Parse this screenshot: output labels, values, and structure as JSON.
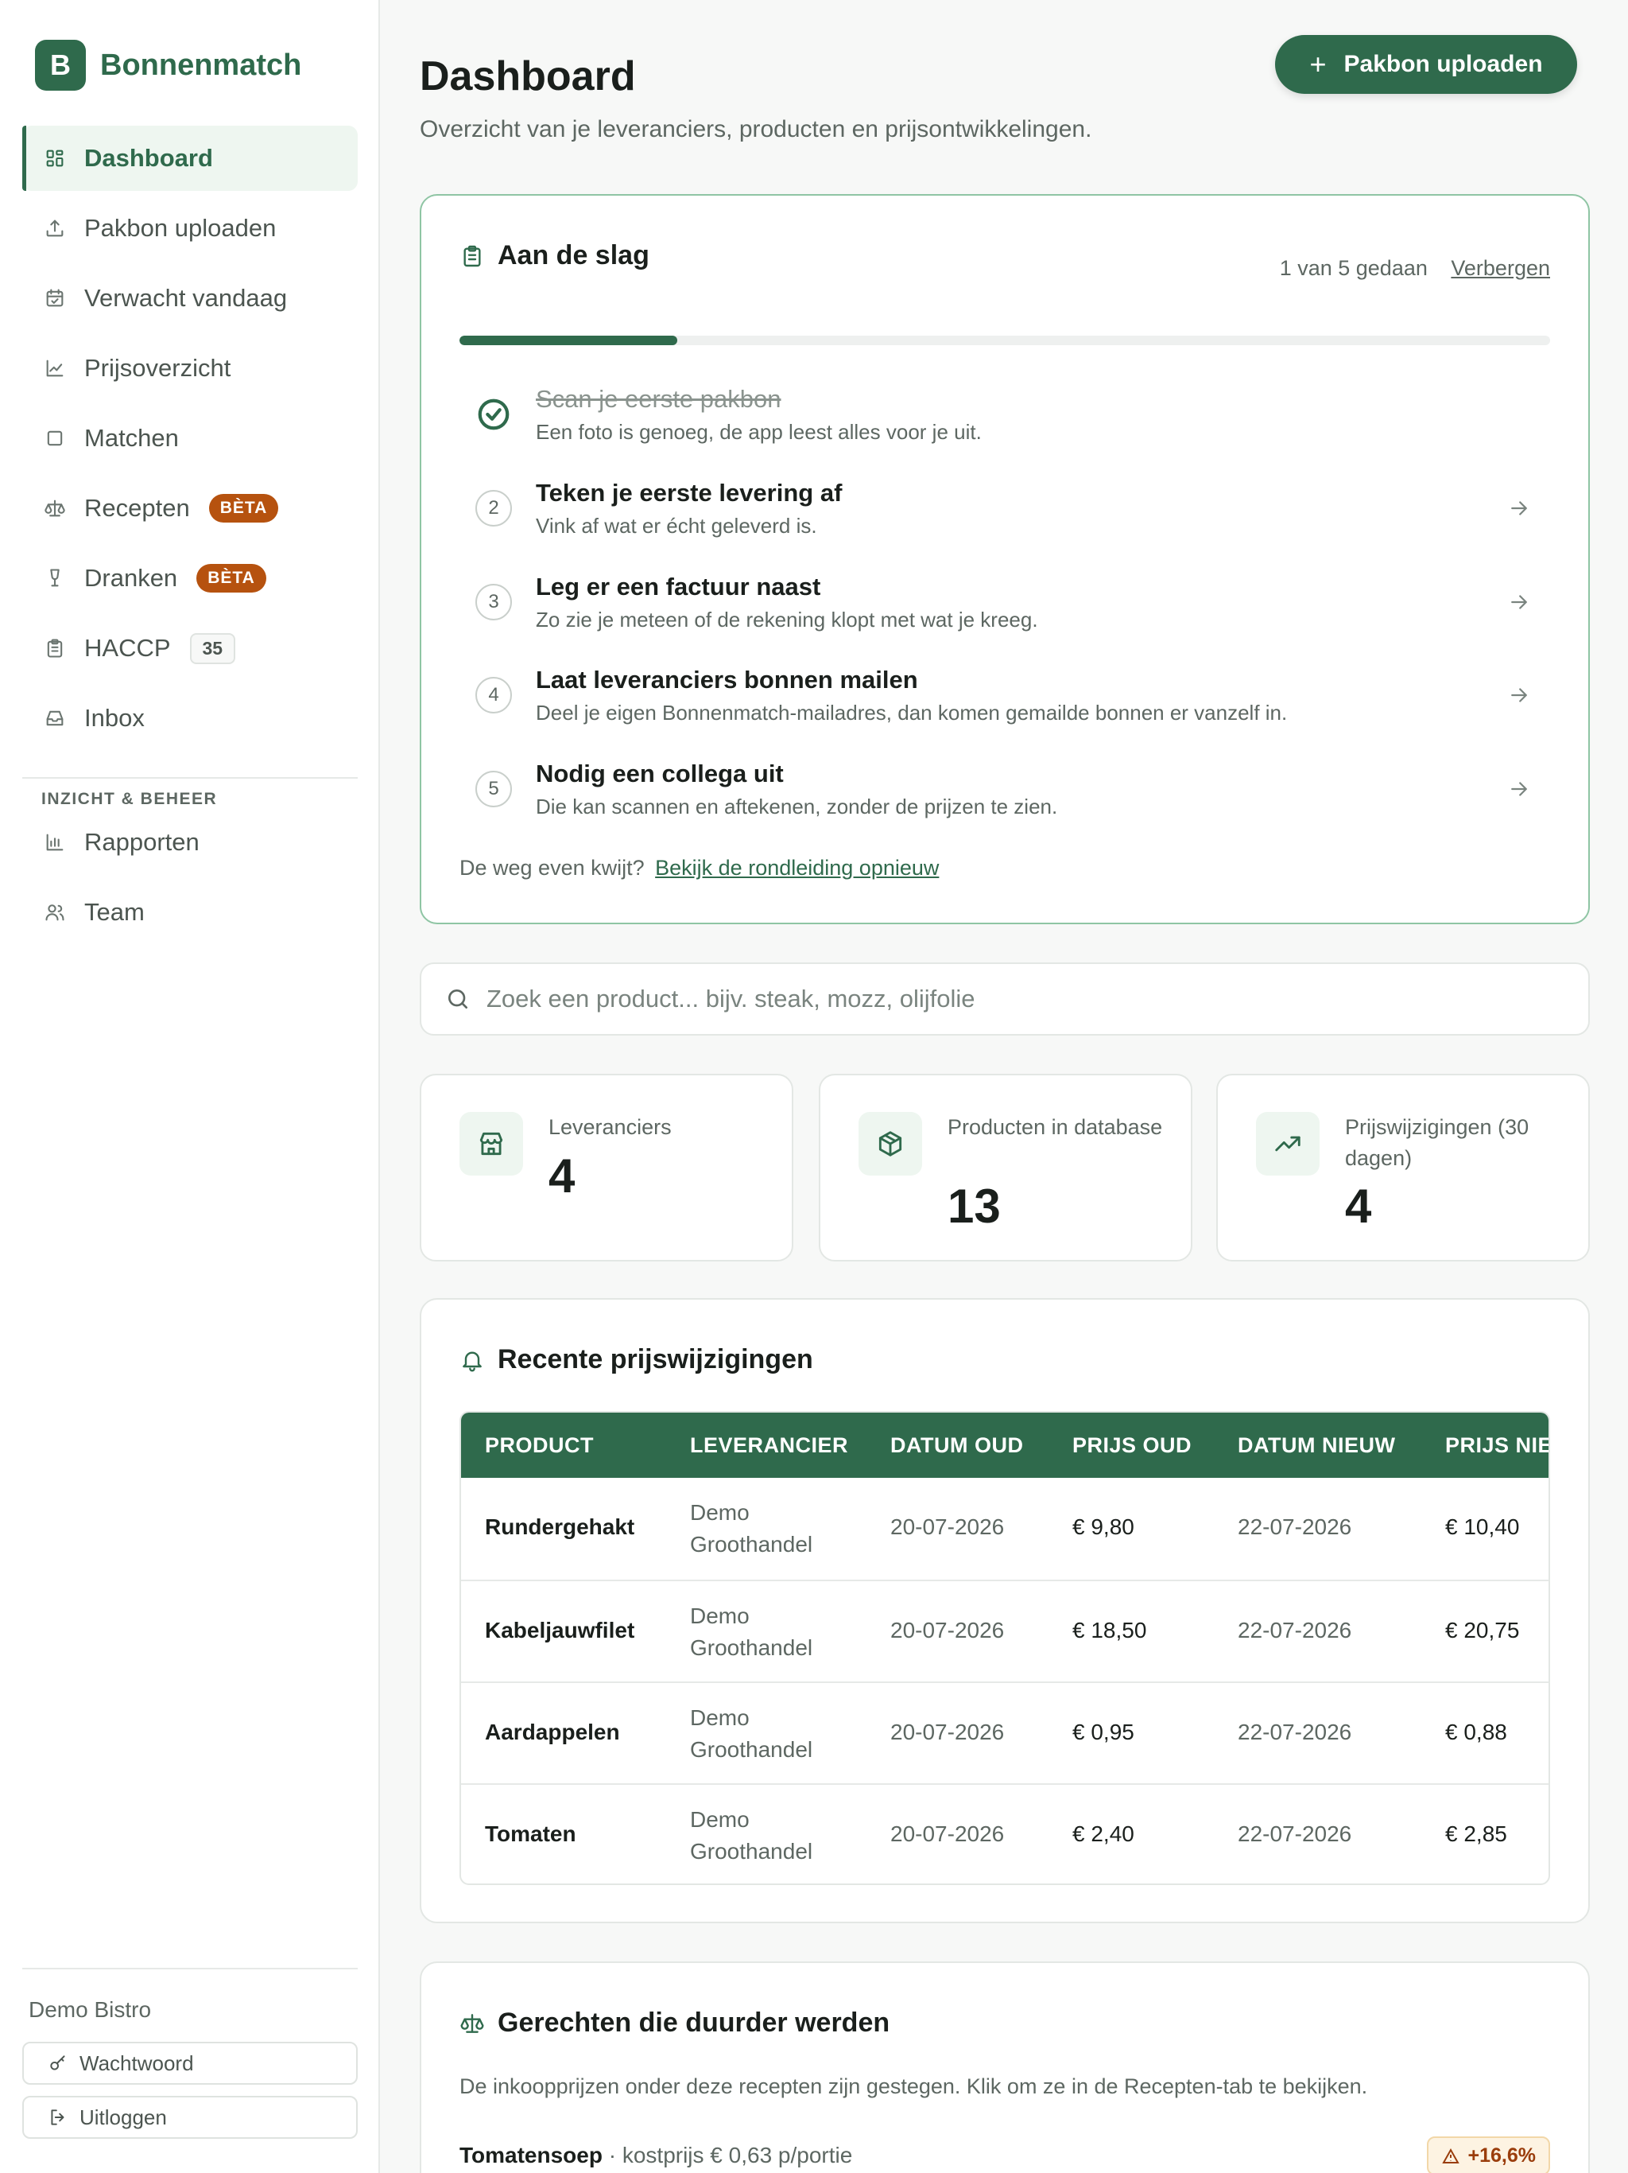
{
  "app": {
    "logo_letter": "B",
    "name": "Bonnenmatch"
  },
  "sidebar": {
    "items": [
      {
        "label": "Dashboard",
        "icon": "grid-icon",
        "active": true
      },
      {
        "label": "Pakbon uploaden",
        "icon": "upload-icon"
      },
      {
        "label": "Verwacht vandaag",
        "icon": "calendar-icon"
      },
      {
        "label": "Prijsoverzicht",
        "icon": "line-chart-icon"
      },
      {
        "label": "Matchen",
        "icon": "square-icon"
      },
      {
        "label": "Recepten",
        "icon": "scale-icon",
        "badge": "BÈTA"
      },
      {
        "label": "Dranken",
        "icon": "wine-glass-icon",
        "badge": "BÈTA"
      },
      {
        "label": "HACCP",
        "icon": "clipboard-icon",
        "count": "35"
      },
      {
        "label": "Inbox",
        "icon": "inbox-icon"
      }
    ],
    "section_label": "INZICHT & BEHEER",
    "items2": [
      {
        "label": "Rapporten",
        "icon": "bar-chart-icon"
      },
      {
        "label": "Team",
        "icon": "users-icon"
      }
    ],
    "account_name": "Demo Bistro",
    "password_label": "Wachtwoord",
    "logout_label": "Uitloggen"
  },
  "header": {
    "title": "Dashboard",
    "subtitle": "Overzicht van je leveranciers, producten en prijsontwikkelingen.",
    "upload_label": "Pakbon uploaden"
  },
  "onboarding": {
    "title": "Aan de slag",
    "progress_text": "1 van 5 gedaan",
    "hide_label": "Verbergen",
    "progress_fraction": 0.2,
    "steps": [
      {
        "num": "1",
        "title": "Scan je eerste pakbon",
        "desc": "Een foto is genoeg, de app leest alles voor je uit.",
        "done": true
      },
      {
        "num": "2",
        "title": "Teken je eerste levering af",
        "desc": "Vink af wat er écht geleverd is."
      },
      {
        "num": "3",
        "title": "Leg er een factuur naast",
        "desc": "Zo zie je meteen of de rekening klopt met wat je kreeg."
      },
      {
        "num": "4",
        "title": "Laat leveranciers bonnen mailen",
        "desc": "Deel je eigen Bonnenmatch-mailadres, dan komen gemailde bonnen er vanzelf in."
      },
      {
        "num": "5",
        "title": "Nodig een collega uit",
        "desc": "Die kan scannen en aftekenen, zonder de prijzen te zien."
      }
    ],
    "footer_text": "De weg even kwijt?",
    "footer_link": "Bekijk de rondleiding opnieuw"
  },
  "search": {
    "placeholder": "Zoek een product... bijv. steak, mozz, olijfolie"
  },
  "stats": [
    {
      "label": "Leveranciers",
      "value": "4",
      "icon": "store-icon"
    },
    {
      "label": "Producten in database",
      "value": "13",
      "icon": "package-icon"
    },
    {
      "label": "Prijswijzigingen (30 dagen)",
      "value": "4",
      "icon": "trending-up-icon"
    }
  ],
  "price_changes": {
    "title": "Recente prijswijzigingen",
    "columns": [
      "PRODUCT",
      "LEVERANCIER",
      "DATUM OUD",
      "PRIJS OUD",
      "DATUM NIEUW",
      "PRIJS NIEUW"
    ],
    "rows": [
      [
        "Rundergehakt",
        "Demo Groothandel",
        "20-07-2026",
        "€ 9,80",
        "22-07-2026",
        "€ 10,40"
      ],
      [
        "Kabeljauwfilet",
        "Demo Groothandel",
        "20-07-2026",
        "€ 18,50",
        "22-07-2026",
        "€ 20,75"
      ],
      [
        "Aardappelen",
        "Demo Groothandel",
        "20-07-2026",
        "€ 0,95",
        "22-07-2026",
        "€ 0,88"
      ],
      [
        "Tomaten",
        "Demo Groothandel",
        "20-07-2026",
        "€ 2,40",
        "22-07-2026",
        "€ 2,85"
      ]
    ]
  },
  "dishes": {
    "title": "Gerechten die duurder werden",
    "desc": "De inkoopprijzen onder deze recepten zijn gestegen. Klik om ze in de Recepten-tab te bekijken.",
    "items": [
      {
        "name": "Tomatensoep",
        "meta": "· kostprijs € 0,63 p/portie",
        "change": "+16,6%"
      }
    ]
  },
  "colors": {
    "brand": "#2f6a4c",
    "beta_badge": "#b6520f",
    "warning": "#9a3d0c"
  }
}
